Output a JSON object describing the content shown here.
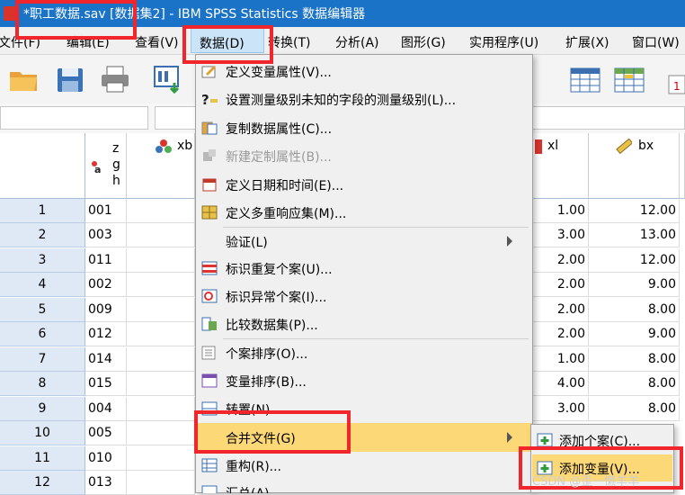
{
  "window": {
    "title": "*职工数据.sav [数据集2] - IBM SPSS Statistics 数据编辑器"
  },
  "menubar": {
    "items": [
      {
        "label": "文件(F)"
      },
      {
        "label": "编辑(E)"
      },
      {
        "label": "查看(V)"
      },
      {
        "label": "数据(D)"
      },
      {
        "label": "转换(T)"
      },
      {
        "label": "分析(A)"
      },
      {
        "label": "图形(G)"
      },
      {
        "label": "实用程序(U)"
      },
      {
        "label": "扩展(X)"
      },
      {
        "label": "窗口(W)"
      }
    ],
    "active": "数据(D)"
  },
  "toolbar": {
    "buttons": [
      "open-folder-icon",
      "save-icon",
      "print-icon",
      "dialog-recall-icon",
      "table-grid-icon",
      "value-labels-icon",
      "extra-icon"
    ]
  },
  "grid": {
    "columns": [
      {
        "name": "zgh",
        "icon": "string-variable-icon"
      },
      {
        "name": "xb",
        "icon": "nominal-variable-icon"
      },
      {
        "name": "xl",
        "icon": "ordinal-variable-icon"
      },
      {
        "name": "bx",
        "icon": "scale-variable-icon"
      }
    ],
    "rows": [
      {
        "n": "1",
        "zgh": "001",
        "xl": "1.00",
        "bx": "12.00"
      },
      {
        "n": "2",
        "zgh": "003",
        "xl": "3.00",
        "bx": "13.00"
      },
      {
        "n": "3",
        "zgh": "011",
        "xl": "2.00",
        "bx": "12.00"
      },
      {
        "n": "4",
        "zgh": "002",
        "xl": "2.00",
        "bx": "9.00"
      },
      {
        "n": "5",
        "zgh": "009",
        "xl": "2.00",
        "bx": "8.00"
      },
      {
        "n": "6",
        "zgh": "012",
        "xl": "2.00",
        "bx": "9.00"
      },
      {
        "n": "7",
        "zgh": "014",
        "xl": "1.00",
        "bx": "8.00"
      },
      {
        "n": "8",
        "zgh": "015",
        "xl": "4.00",
        "bx": "8.00"
      },
      {
        "n": "9",
        "zgh": "004",
        "xl": "3.00",
        "bx": "8.00"
      },
      {
        "n": "10",
        "zgh": "005",
        "xl": "",
        "bx": ""
      },
      {
        "n": "11",
        "zgh": "010",
        "xl": "",
        "bx": ""
      },
      {
        "n": "12",
        "zgh": "013",
        "xl": "",
        "bx": ""
      }
    ]
  },
  "data_menu": {
    "items": [
      {
        "label": "定义变量属性(V)...",
        "icon": "define-properties-icon"
      },
      {
        "label": "设置测量级别未知的字段的测量级别(L)...",
        "icon": "question-ruler-icon"
      },
      {
        "label": "复制数据属性(C)...",
        "icon": "copy-properties-icon"
      },
      {
        "label": "新建定制属性(B)...",
        "icon": "custom-attribute-icon",
        "disabled": true
      },
      {
        "label": "定义日期和时间(E)...",
        "icon": "calendar-icon"
      },
      {
        "label": "定义多重响应集(M)...",
        "icon": "multi-response-icon"
      },
      {
        "label": "验证(L)",
        "icon": "",
        "submenu": true
      },
      {
        "label": "标识重复个案(U)...",
        "icon": "duplicate-cases-icon"
      },
      {
        "label": "标识异常个案(I)...",
        "icon": "unusual-cases-icon"
      },
      {
        "label": "比较数据集(P)...",
        "icon": "compare-datasets-icon"
      },
      {
        "label": "个案排序(O)...",
        "icon": "sort-cases-icon"
      },
      {
        "label": "变量排序(B)...",
        "icon": "sort-variables-icon"
      },
      {
        "label": "转置(N)...",
        "icon": "transpose-icon"
      },
      {
        "label": "合并文件(G)",
        "icon": "",
        "submenu": true,
        "highlighted": true
      },
      {
        "label": "重构(R)...",
        "icon": "restructure-icon"
      },
      {
        "label": "汇总(A)...",
        "icon": "aggregate-icon"
      }
    ]
  },
  "merge_submenu": {
    "items": [
      {
        "label": "添加个案(C)...",
        "icon": "add-cases-icon"
      },
      {
        "label": "添加变量(V)...",
        "icon": "add-variables-icon",
        "highlighted": true
      }
    ]
  },
  "watermark": "CSDN @歪一懒羊羊",
  "colors": {
    "title_bar": "#1a73c7",
    "menu_highlight": "#fdd876",
    "annotation_red": "#f0262c",
    "row_header": "#dfe9f6"
  }
}
